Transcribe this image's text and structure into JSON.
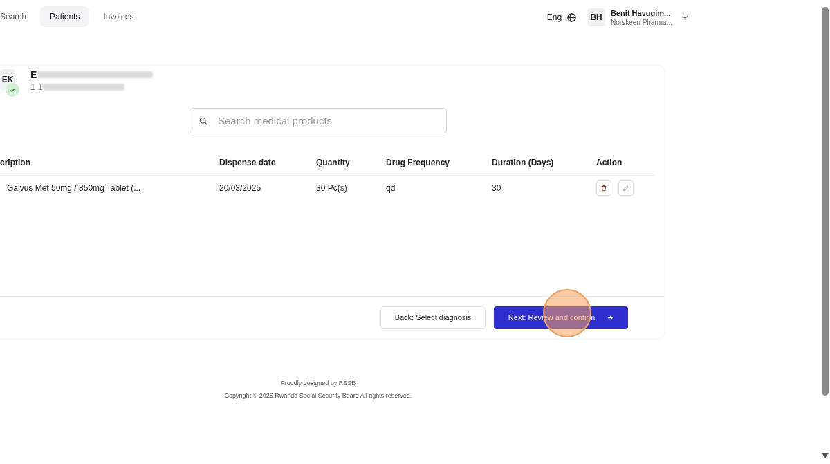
{
  "nav": {
    "tabs": [
      {
        "label": "Search",
        "selected": false
      },
      {
        "label": "Patients",
        "selected": true
      },
      {
        "label": "Invoices",
        "selected": false
      }
    ],
    "language": "Eng",
    "user": {
      "initials": "BH",
      "name": "Benit Havugim...",
      "organization": "Norskeen Pharma..."
    }
  },
  "patient": {
    "initials": "EK",
    "verified": true,
    "name": "E",
    "id": "1 1"
  },
  "search": {
    "placeholder": "Search medical products"
  },
  "table": {
    "columns": [
      "cription",
      "Dispense date",
      "Quantity",
      "Drug Frequency",
      "Duration (Days)",
      "Action"
    ],
    "rows": [
      {
        "cells": [
          "Galvus Met 50mg / 850mg Tablet (...",
          "20/03/2025",
          "30 Pc(s)",
          "qd",
          "30"
        ]
      }
    ]
  },
  "buttons": {
    "back": "Back: Select diagnosis",
    "next": "Next: Review and confirm"
  },
  "footer": {
    "credit": "Proudly designed by RSSB",
    "copyright": "Copyright © 2025 Rwanda Social Security Board All rights reserved."
  }
}
